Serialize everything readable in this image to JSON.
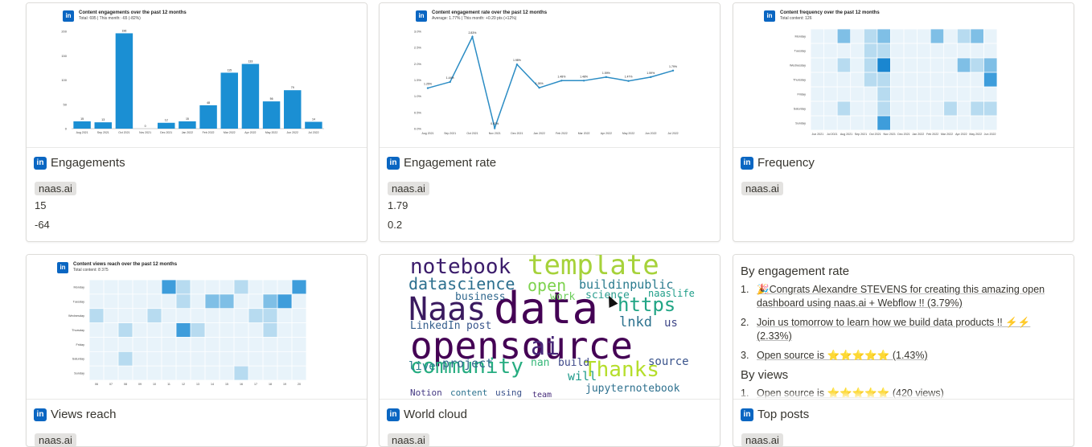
{
  "cards": {
    "engagements": {
      "title": "Engagements",
      "tag": "naas.ai",
      "value1": "15",
      "value2": "-64",
      "chart_title": "Content engagements over the past 12 months",
      "chart_subtitle": "Total: 695 | This month: -65 (-82%)"
    },
    "engagement_rate": {
      "title": "Engagement rate",
      "tag": "naas.ai",
      "value1": "1.79",
      "value2": "0.2",
      "chart_title": "Content engagement rate over the past 12 months",
      "chart_subtitle": "Average: 1.77% | This month: +0.20 pts (+12%)"
    },
    "frequency": {
      "title": "Frequency",
      "tag": "naas.ai",
      "chart_title": "Content frequency over the past 12 months",
      "chart_subtitle": "Total content: 126"
    },
    "views_reach": {
      "title": "Views reach",
      "tag": "naas.ai",
      "chart_title": "Content views reach over the past 12 months",
      "chart_subtitle": "Total content: 8 375"
    },
    "world_cloud": {
      "title": "World cloud",
      "tag": "naas.ai"
    },
    "top_posts": {
      "title": "Top posts",
      "tag": "naas.ai",
      "by_engagement_heading": "By engagement rate",
      "by_engagement": [
        {
          "num": "1.",
          "text": "🎉Congrats Alexandre STEVENS for creating this amazing open dashboard using naas.ai + Webflow !!  (3.79%)"
        },
        {
          "num": "2.",
          "text": "Join us tomorrow to learn how we build data products !! ⚡⚡ (2.33%)"
        },
        {
          "num": "3.",
          "text": "Open source is ⭐⭐⭐⭐⭐ (1.43%)"
        }
      ],
      "by_views_heading": "By views",
      "by_views": [
        {
          "num": "1.",
          "text": "Open source is ⭐⭐⭐⭐⭐ (420 views)"
        }
      ]
    }
  },
  "colors": {
    "bar": "#1b8fd3",
    "line": "#2b8cc4",
    "heat_light": "#e8f3fa",
    "heat_dark": "#1a86d0",
    "linkedin": "#0a66c2"
  },
  "chart_data": [
    {
      "type": "bar",
      "title": "Content engagements over the past 12 months",
      "categories": [
        "Aug 2021",
        "Sep 2021",
        "Oct 2021",
        "Nov 2021",
        "Dec 2021",
        "Jan 2022",
        "Feb 2022",
        "Mar 2022",
        "Apr 2022",
        "May 2022",
        "Jun 2022",
        "Jul 2022"
      ],
      "values": [
        15,
        13,
        196,
        0,
        12,
        15,
        48,
        115,
        133,
        56,
        79,
        14
      ],
      "yticks": [
        0,
        50,
        100,
        150,
        200
      ],
      "ylim": [
        0,
        200
      ]
    },
    {
      "type": "line",
      "title": "Content engagement rate over the past 12 months",
      "categories": [
        "Aug 2021",
        "Sep 2021",
        "Oct 2021",
        "Nov 2021",
        "Dec 2021",
        "Jan 2022",
        "Feb 2022",
        "Mar 2022",
        "Apr 2022",
        "May 2022",
        "Jun 2022",
        "Jul 2022"
      ],
      "values": [
        1.25,
        1.44,
        2.83,
        0.02,
        1.98,
        1.26,
        1.48,
        1.48,
        1.59,
        1.47,
        1.59,
        1.79
      ],
      "labels": [
        "1.25%",
        "1.44%",
        "2.83%",
        "0.02%",
        "1.98%",
        "1.26%",
        "1.48%",
        "1.48%",
        "1.59%",
        "1.47%",
        "1.59%",
        "1.79%"
      ],
      "yticks": [
        "0.0%",
        "0.5%",
        "1.0%",
        "1.5%",
        "2.0%",
        "2.5%",
        "3.0%"
      ],
      "ylim": [
        0,
        3.0
      ]
    },
    {
      "type": "heatmap",
      "title": "Content frequency over the past 12 months",
      "rows": [
        "Monday",
        "Tuesday",
        "Wednesday",
        "Thursday",
        "Friday",
        "Saturday",
        "Sunday"
      ],
      "columns": [
        "Jun 2021",
        "Jul 2021",
        "Aug 2021",
        "Sep 2021",
        "Oct 2021",
        "Nov 2021",
        "Dec 2021",
        "Jan 2022",
        "Feb 2022",
        "Mar 2022",
        "Apr 2022",
        "May 2022",
        "Jun 2022"
      ],
      "values": [
        [
          1,
          1,
          3,
          1,
          2,
          3,
          1,
          1,
          1,
          3,
          1,
          2,
          3,
          1
        ],
        [
          1,
          1,
          1,
          1,
          2,
          2,
          1,
          1,
          1,
          1,
          1,
          1,
          1,
          1
        ],
        [
          1,
          1,
          2,
          1,
          2,
          5,
          1,
          1,
          1,
          1,
          1,
          3,
          2,
          3
        ],
        [
          1,
          1,
          1,
          1,
          2,
          2,
          1,
          1,
          1,
          1,
          1,
          1,
          1,
          4
        ],
        [
          1,
          1,
          1,
          1,
          1,
          2,
          1,
          1,
          1,
          1,
          1,
          1,
          1,
          1
        ],
        [
          1,
          1,
          2,
          1,
          1,
          2,
          1,
          1,
          1,
          1,
          2,
          1,
          2,
          2
        ],
        [
          1,
          1,
          1,
          1,
          1,
          4,
          1,
          1,
          1,
          1,
          1,
          1,
          1,
          1
        ]
      ]
    },
    {
      "type": "heatmap",
      "title": "Content views reach over the past 12 months",
      "rows": [
        "Monday",
        "Tuesday",
        "Wednesday",
        "Thursday",
        "Friday",
        "Saturday",
        "Sunday"
      ],
      "columns": [
        "06",
        "07",
        "08",
        "09",
        "10",
        "11",
        "12",
        "13",
        "14",
        "15",
        "16",
        "17",
        "18",
        "19",
        "20"
      ],
      "values": [
        [
          1,
          1,
          1,
          1,
          1,
          4,
          2,
          1,
          1,
          1,
          2,
          1,
          1,
          1,
          4
        ],
        [
          1,
          1,
          1,
          1,
          1,
          1,
          2,
          1,
          3,
          3,
          1,
          1,
          3,
          4,
          1
        ],
        [
          2,
          1,
          1,
          1,
          2,
          1,
          1,
          1,
          1,
          1,
          1,
          2,
          2,
          1,
          1
        ],
        [
          1,
          1,
          2,
          1,
          1,
          1,
          4,
          2,
          1,
          1,
          1,
          1,
          2,
          1,
          1
        ],
        [
          1,
          1,
          1,
          1,
          1,
          1,
          1,
          1,
          1,
          1,
          1,
          1,
          1,
          1,
          1
        ],
        [
          1,
          1,
          2,
          1,
          1,
          1,
          1,
          1,
          1,
          1,
          1,
          1,
          1,
          1,
          1
        ],
        [
          1,
          1,
          1,
          1,
          1,
          1,
          1,
          1,
          1,
          1,
          2,
          1,
          1,
          1,
          1
        ]
      ]
    }
  ],
  "wordcloud": [
    {
      "w": "notebook",
      "c": "#3b1c6b",
      "s": 26
    },
    {
      "w": "template",
      "c": "#a6d23a",
      "s": 34
    },
    {
      "w": "datascience",
      "c": "#2c6f8e",
      "s": 20
    },
    {
      "w": "open",
      "c": "#7ed34f",
      "s": 20
    },
    {
      "w": "buildinpublic",
      "c": "#2a7b8e",
      "s": 15
    },
    {
      "w": "Naas",
      "c": "#3a1a5f",
      "s": 40
    },
    {
      "w": "data",
      "c": "#440154",
      "s": 54
    },
    {
      "w": "https",
      "c": "#21a585",
      "s": 24
    },
    {
      "w": "business",
      "c": "#31688e",
      "s": 13
    },
    {
      "w": "work",
      "c": "#6ccd5a",
      "s": 13
    },
    {
      "w": "science",
      "c": "#2a9d8f",
      "s": 13
    },
    {
      "w": "naaslife",
      "c": "#1f9e89",
      "s": 12
    },
    {
      "w": "LinkedIn",
      "c": "#355f8d",
      "s": 13
    },
    {
      "w": "post",
      "c": "#39568c",
      "s": 13
    },
    {
      "w": "lnkd",
      "c": "#2c728e",
      "s": 17
    },
    {
      "w": "us",
      "c": "#3f4788",
      "s": 14
    },
    {
      "w": "opensource",
      "c": "#440154",
      "s": 46
    },
    {
      "w": "community",
      "c": "#27ad81",
      "s": 26
    },
    {
      "w": "ai",
      "c": "#482878",
      "s": 30
    },
    {
      "w": "Thanks",
      "c": "#b5de2b",
      "s": 26
    },
    {
      "w": "project",
      "c": "#31688e",
      "s": 15
    },
    {
      "w": "nan",
      "c": "#35b779",
      "s": 13
    },
    {
      "w": "build",
      "c": "#3e4989",
      "s": 13
    },
    {
      "w": "will",
      "c": "#1f9a8a",
      "s": 15
    },
    {
      "w": "source",
      "c": "#3a548c",
      "s": 14
    },
    {
      "w": "live",
      "c": "#287d8e",
      "s": 14
    },
    {
      "w": "jupyternotebook",
      "c": "#2d708e",
      "s": 13
    },
    {
      "w": "Notion",
      "c": "#443983",
      "s": 11
    },
    {
      "w": "content",
      "c": "#2c728e",
      "s": 11
    },
    {
      "w": "using",
      "c": "#3b528b",
      "s": 11
    },
    {
      "w": "team",
      "c": "#472d7b",
      "s": 10
    }
  ]
}
